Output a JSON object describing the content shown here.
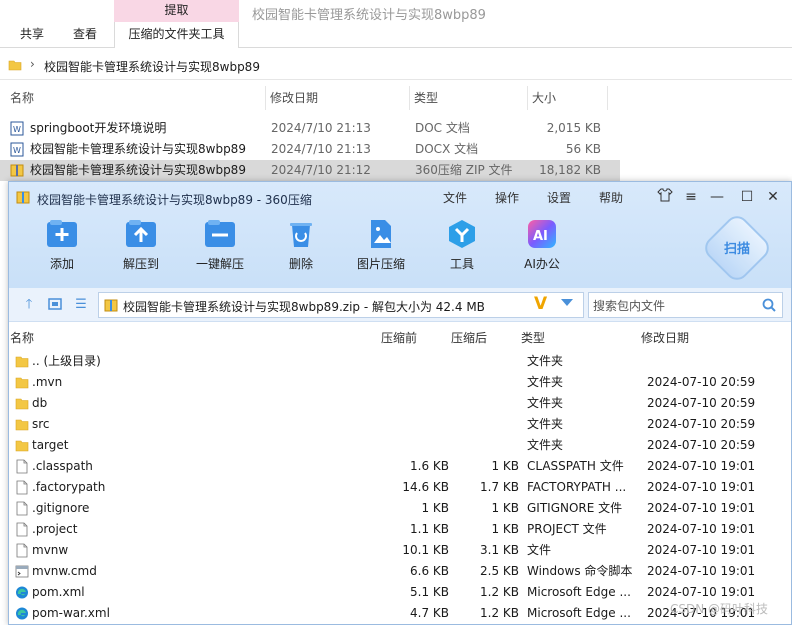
{
  "explorer": {
    "ribbon": {
      "context_tab": "提取",
      "tabs": [
        "共享",
        "查看"
      ],
      "active_tab": "压缩的文件夹工具",
      "window_title": "校园智能卡管理系统设计与实现8wbp89"
    },
    "address": {
      "path": "校园智能卡管理系统设计与实现8wbp89"
    },
    "columns": [
      "名称",
      "修改日期",
      "类型",
      "大小"
    ],
    "files": [
      {
        "name": "springboot开发环境说明",
        "date": "2024/7/10 21:13",
        "type": "DOC 文档",
        "size": "2,015 KB",
        "icon": "word-doc-icon"
      },
      {
        "name": "校园智能卡管理系统设计与实现8wbp89",
        "date": "2024/7/10 21:13",
        "type": "DOCX 文档",
        "size": "56 KB",
        "icon": "word-docx-icon"
      },
      {
        "name": "校园智能卡管理系统设计与实现8wbp89",
        "date": "2024/7/10 21:12",
        "type": "360压缩 ZIP 文件",
        "size": "18,182 KB",
        "icon": "zip-archive-icon",
        "selected": true
      }
    ]
  },
  "zip_window": {
    "title": "校园智能卡管理系统设计与实现8wbp89 - 360压缩",
    "menu": [
      "文件",
      "操作",
      "设置",
      "帮助"
    ],
    "window_buttons": [
      "skin",
      "menu",
      "minimize",
      "maximize",
      "close"
    ],
    "toolbar": [
      {
        "label": "添加",
        "icon": "add-icon",
        "color": "#3a8ee6"
      },
      {
        "label": "解压到",
        "icon": "extract-to-icon",
        "color": "#3a8ee6"
      },
      {
        "label": "一键解压",
        "icon": "one-click-extract-icon",
        "color": "#3a8ee6"
      },
      {
        "label": "删除",
        "icon": "delete-icon",
        "color": "#3a8ee6"
      },
      {
        "label": "图片压缩",
        "icon": "image-compress-icon",
        "color": "#3a8ee6"
      },
      {
        "label": "工具",
        "icon": "tools-icon",
        "color": "#2d9fe8"
      },
      {
        "label": "AI办公",
        "icon": "ai-office-icon",
        "color": "#6a5cf0"
      }
    ],
    "scan_label": "扫描",
    "path_text": "校园智能卡管理系统设计与实现8wbp89.zip - 解包大小为 42.4 MB",
    "path_badge": "V",
    "search_placeholder": "搜索包内文件",
    "columns": [
      "名称",
      "压缩前",
      "压缩后",
      "类型",
      "修改日期"
    ],
    "entries": [
      {
        "name": ".. (上级目录)",
        "before": "",
        "after": "",
        "type": "文件夹",
        "date": "",
        "icon": "folder-icon"
      },
      {
        "name": ".mvn",
        "before": "",
        "after": "",
        "type": "文件夹",
        "date": "2024-07-10 20:59",
        "icon": "folder-icon"
      },
      {
        "name": "db",
        "before": "",
        "after": "",
        "type": "文件夹",
        "date": "2024-07-10 20:59",
        "icon": "folder-icon"
      },
      {
        "name": "src",
        "before": "",
        "after": "",
        "type": "文件夹",
        "date": "2024-07-10 20:59",
        "icon": "folder-icon"
      },
      {
        "name": "target",
        "before": "",
        "after": "",
        "type": "文件夹",
        "date": "2024-07-10 20:59",
        "icon": "folder-icon"
      },
      {
        "name": ".classpath",
        "before": "1.6 KB",
        "after": "1 KB",
        "type": "CLASSPATH 文件",
        "date": "2024-07-10 19:01",
        "icon": "file-icon"
      },
      {
        "name": ".factorypath",
        "before": "14.6 KB",
        "after": "1.7 KB",
        "type": "FACTORYPATH ...",
        "date": "2024-07-10 19:01",
        "icon": "file-icon"
      },
      {
        "name": ".gitignore",
        "before": "1 KB",
        "after": "1 KB",
        "type": "GITIGNORE 文件",
        "date": "2024-07-10 19:01",
        "icon": "file-icon"
      },
      {
        "name": ".project",
        "before": "1.1 KB",
        "after": "1 KB",
        "type": "PROJECT 文件",
        "date": "2024-07-10 19:01",
        "icon": "file-icon"
      },
      {
        "name": "mvnw",
        "before": "10.1 KB",
        "after": "3.1 KB",
        "type": "文件",
        "date": "2024-07-10 19:01",
        "icon": "file-icon"
      },
      {
        "name": "mvnw.cmd",
        "before": "6.6 KB",
        "after": "2.5 KB",
        "type": "Windows 命令脚本",
        "date": "2024-07-10 19:01",
        "icon": "cmd-script-icon"
      },
      {
        "name": "pom.xml",
        "before": "5.1 KB",
        "after": "1.2 KB",
        "type": "Microsoft Edge ...",
        "date": "2024-07-10 19:01",
        "icon": "edge-icon"
      },
      {
        "name": "pom-war.xml",
        "before": "4.7 KB",
        "after": "1.2 KB",
        "type": "Microsoft Edge ...",
        "date": "2024-07-10 19:01",
        "icon": "edge-icon"
      }
    ]
  },
  "watermark": "CSDN @码叶科技"
}
